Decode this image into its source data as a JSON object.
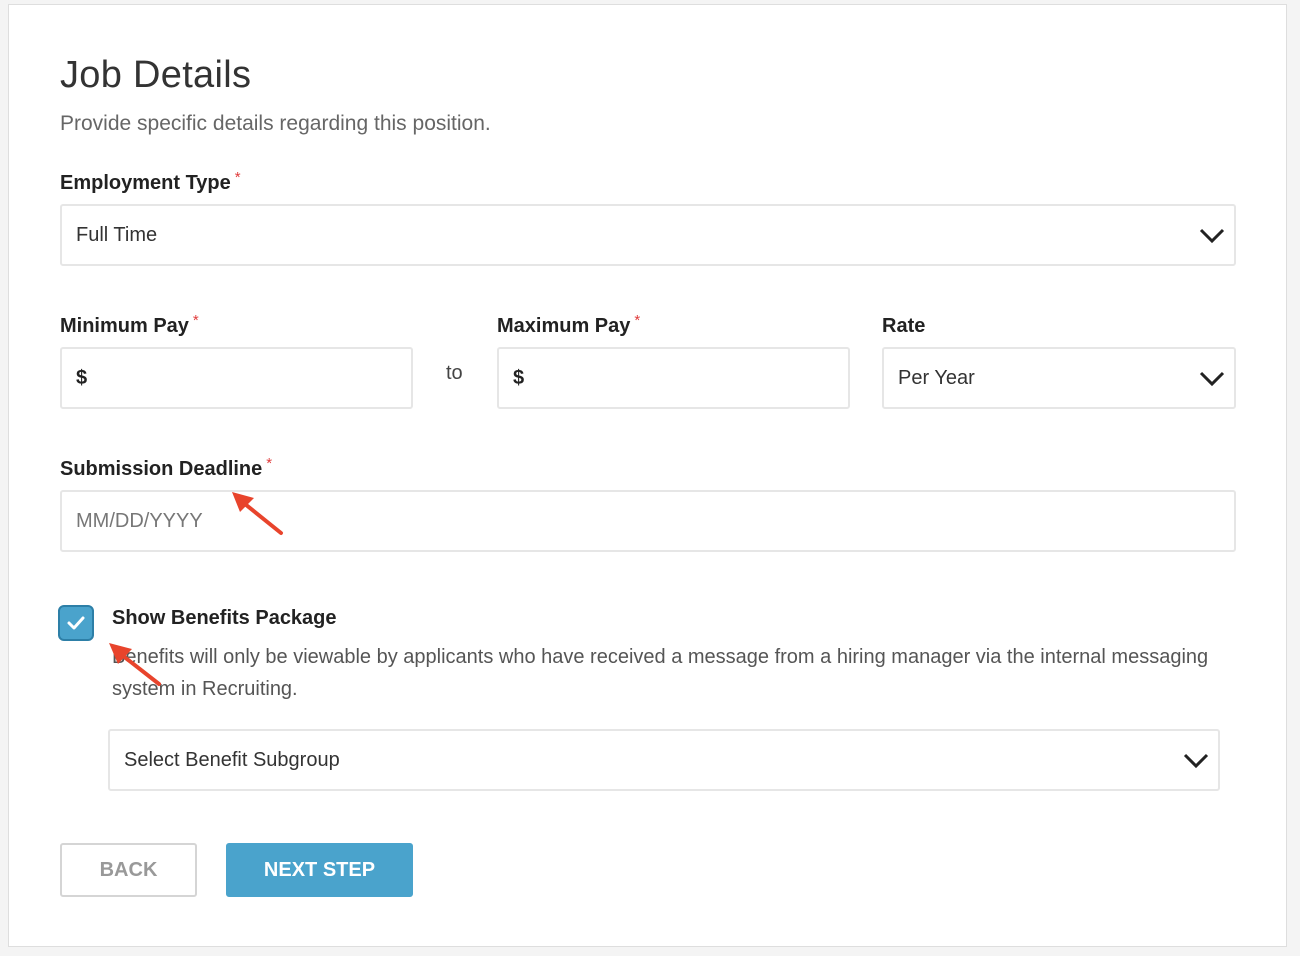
{
  "page": {
    "title": "Job Details",
    "subtitle": "Provide specific details regarding this position."
  },
  "employment_type": {
    "label": "Employment Type",
    "required_mark": "*",
    "value": "Full Time"
  },
  "minimum_pay": {
    "label": "Minimum Pay",
    "required_mark": "*",
    "prefix": "$",
    "value": ""
  },
  "range_separator": "to",
  "maximum_pay": {
    "label": "Maximum Pay",
    "required_mark": "*",
    "prefix": "$",
    "value": ""
  },
  "rate": {
    "label": "Rate",
    "value": "Per Year"
  },
  "submission_deadline": {
    "label": "Submission Deadline",
    "required_mark": "*",
    "placeholder": "MM/DD/YYYY"
  },
  "benefits": {
    "checked": true,
    "label": "Show Benefits Package",
    "description": "Benefits will only be viewable by applicants who have received a message from a hiring manager via the internal messaging system in Recruiting.",
    "subgroup_placeholder": "Select Benefit Subgroup"
  },
  "actions": {
    "back_label": "BACK",
    "next_label": "NEXT STEP"
  },
  "colors": {
    "accent": "#4aa3cc",
    "required": "#e03c3c",
    "annotation_arrow": "#e8442c"
  },
  "icons": {
    "dropdown": "chevron-down-icon",
    "checkbox": "checkmark-icon",
    "annotation": "red-arrow-icon"
  }
}
